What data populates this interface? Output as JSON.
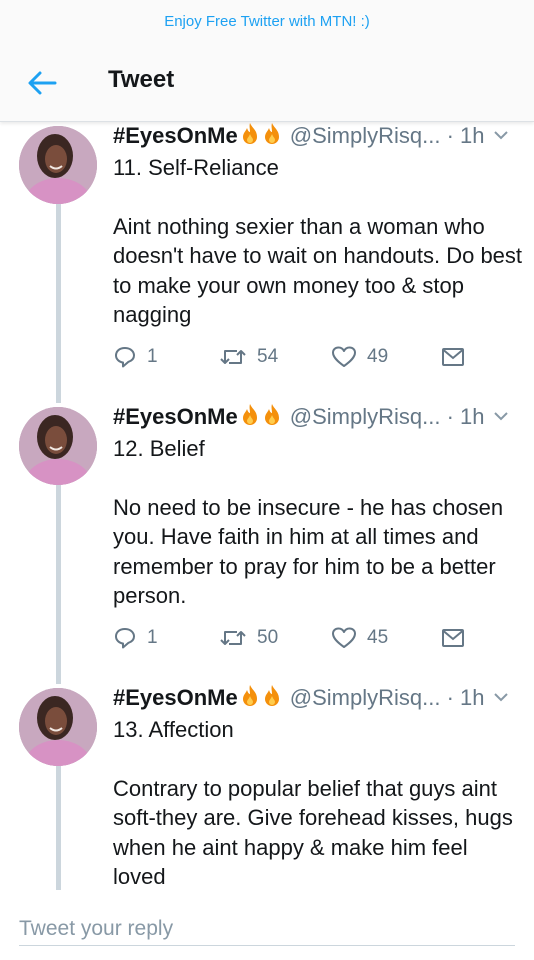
{
  "promo": {
    "text": "Enjoy Free Twitter with MTN! :)"
  },
  "header": {
    "title": "Tweet",
    "back_icon": "arrow-left-icon"
  },
  "colors": {
    "accent": "#1da1f2",
    "secondary_text": "#657786",
    "divider": "#ccd6dd"
  },
  "tweets": [
    {
      "display_name": "#EyesOnMe",
      "handle": "@SimplyRisq...",
      "time": "· 1h",
      "subject": "11. Self-Reliance",
      "body": "Aint nothing sexier than a woman who doesn't have to wait on handouts. Do best to make your own money too & stop nagging",
      "replies": "1",
      "retweets": "54",
      "likes": "49"
    },
    {
      "display_name": "#EyesOnMe",
      "handle": "@SimplyRisq...",
      "time": "· 1h",
      "subject": "12. Belief",
      "body": "No need to be insecure - he has chosen you. Have faith in him at all times and remember to pray for him to be a better person.",
      "replies": "1",
      "retweets": "50",
      "likes": "45"
    },
    {
      "display_name": "#EyesOnMe",
      "handle": "@SimplyRisq...",
      "time": "· 1h",
      "subject": "13. Affection",
      "body": "Contrary to popular belief that guys aint soft-they are. Give forehead kisses, hugs when he aint happy & make him feel loved"
    }
  ],
  "reply": {
    "placeholder": "Tweet your reply"
  }
}
